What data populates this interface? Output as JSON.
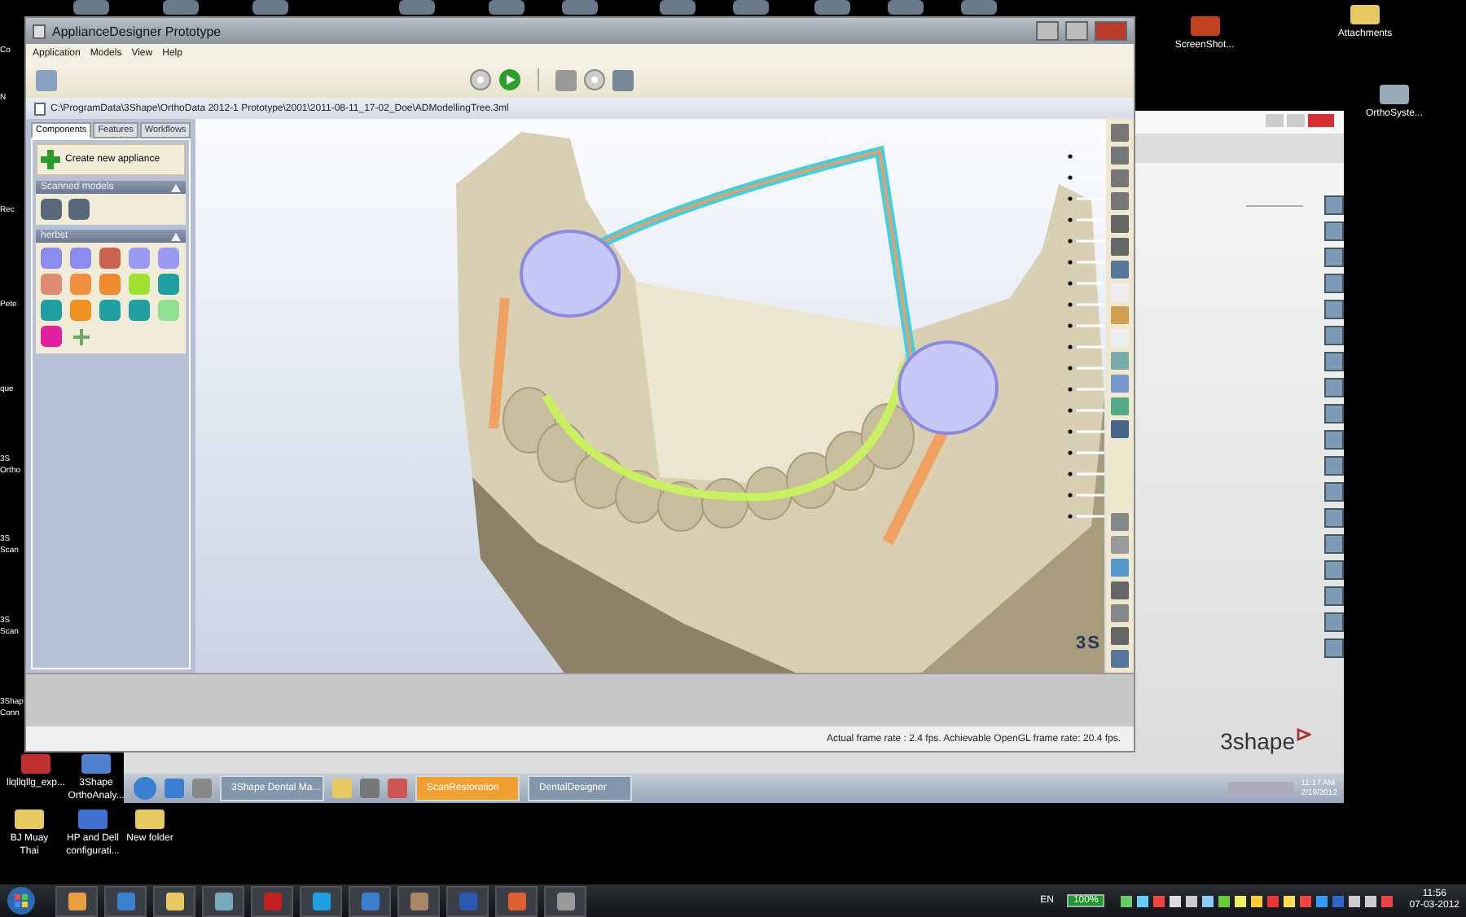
{
  "main_window": {
    "title": "ApplianceDesigner Prototype",
    "menu": [
      "Application",
      "Models",
      "View",
      "Help"
    ],
    "path": "C:\\ProgramData\\3Shape\\OrthoData 2012-1 Prototype\\2001\\2011-08-11_17-02_Doe\\ADModellingTree.3ml",
    "tabs": [
      {
        "label": "Components",
        "selected": true
      },
      {
        "label": "Features",
        "selected": false
      },
      {
        "label": "Workflows",
        "selected": false
      }
    ],
    "create_button": "Create new appliance",
    "sections": [
      "Scanned models",
      "herbst"
    ],
    "viewport_logo": "3S",
    "status": "Actual frame rate : 2.4 fps. Achievable OpenGL frame rate: 20.4 fps."
  },
  "background_window": {
    "logo": "3shape",
    "taskbar_items": [
      {
        "label": "3Shape Dental Ma...",
        "selected": false
      },
      {
        "label": "ScanRestoration",
        "selected": true
      },
      {
        "label": "DentalDesigner",
        "selected": false
      }
    ],
    "time": "11:17 AM",
    "date": "2/19/2012"
  },
  "desktop_icons": [
    "ScreenShot...",
    "Attachments",
    "OrthoSyste...",
    "llqllqllg_exp...",
    "3Shape OrthoAnaly...",
    "BJ Muay Thai",
    "HP and Dell configurati...",
    "New folder"
  ],
  "desktop_edge_labels": [
    "Co",
    "N",
    "Rec",
    "Pete",
    "que",
    "3S Ortho",
    "3S Scan",
    "3S Scan",
    "3Shap Conn"
  ],
  "taskbar": {
    "language": "EN",
    "battery": "100%",
    "time": "11:56",
    "date": "07-03-2012"
  }
}
